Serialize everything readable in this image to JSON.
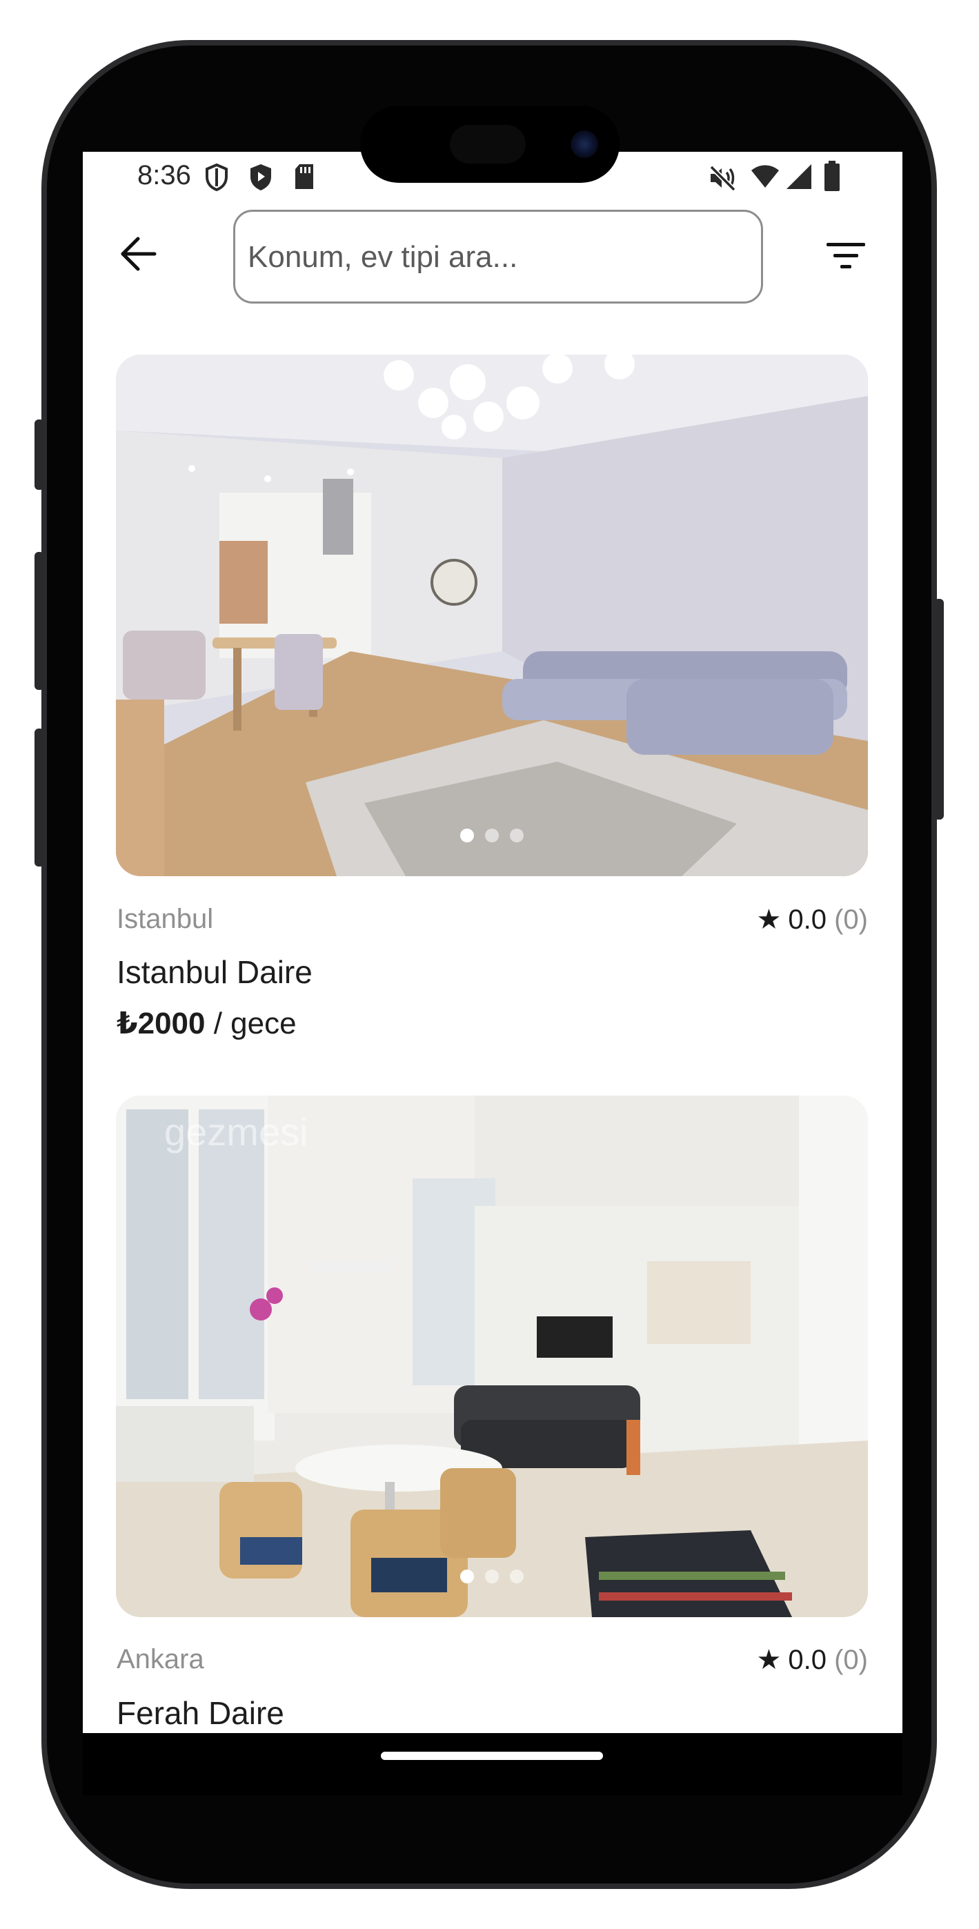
{
  "status_bar": {
    "time": "8:36",
    "icons_left": [
      "shield-outline-icon",
      "play-shield-icon",
      "sd-card-icon"
    ],
    "icons_right": [
      "mute-icon",
      "wifi-icon",
      "signal-icon",
      "battery-icon"
    ]
  },
  "header": {
    "back_icon": "arrow-left-icon",
    "search_placeholder": "Konum, ev tipi ara...",
    "filter_icon": "filter-icon"
  },
  "listings": [
    {
      "location": "Istanbul",
      "rating": "0.0",
      "review_count": "(0)",
      "title": "Istanbul Daire",
      "price": "₺2000",
      "price_unit": " / gece",
      "image_dots": 3,
      "active_dot": 0
    },
    {
      "location": "Ankara",
      "rating": "0.0",
      "review_count": "(0)",
      "title": "Ferah Daire",
      "image_watermark": "gezmesi",
      "image_dots": 3,
      "active_dot": 0
    }
  ]
}
